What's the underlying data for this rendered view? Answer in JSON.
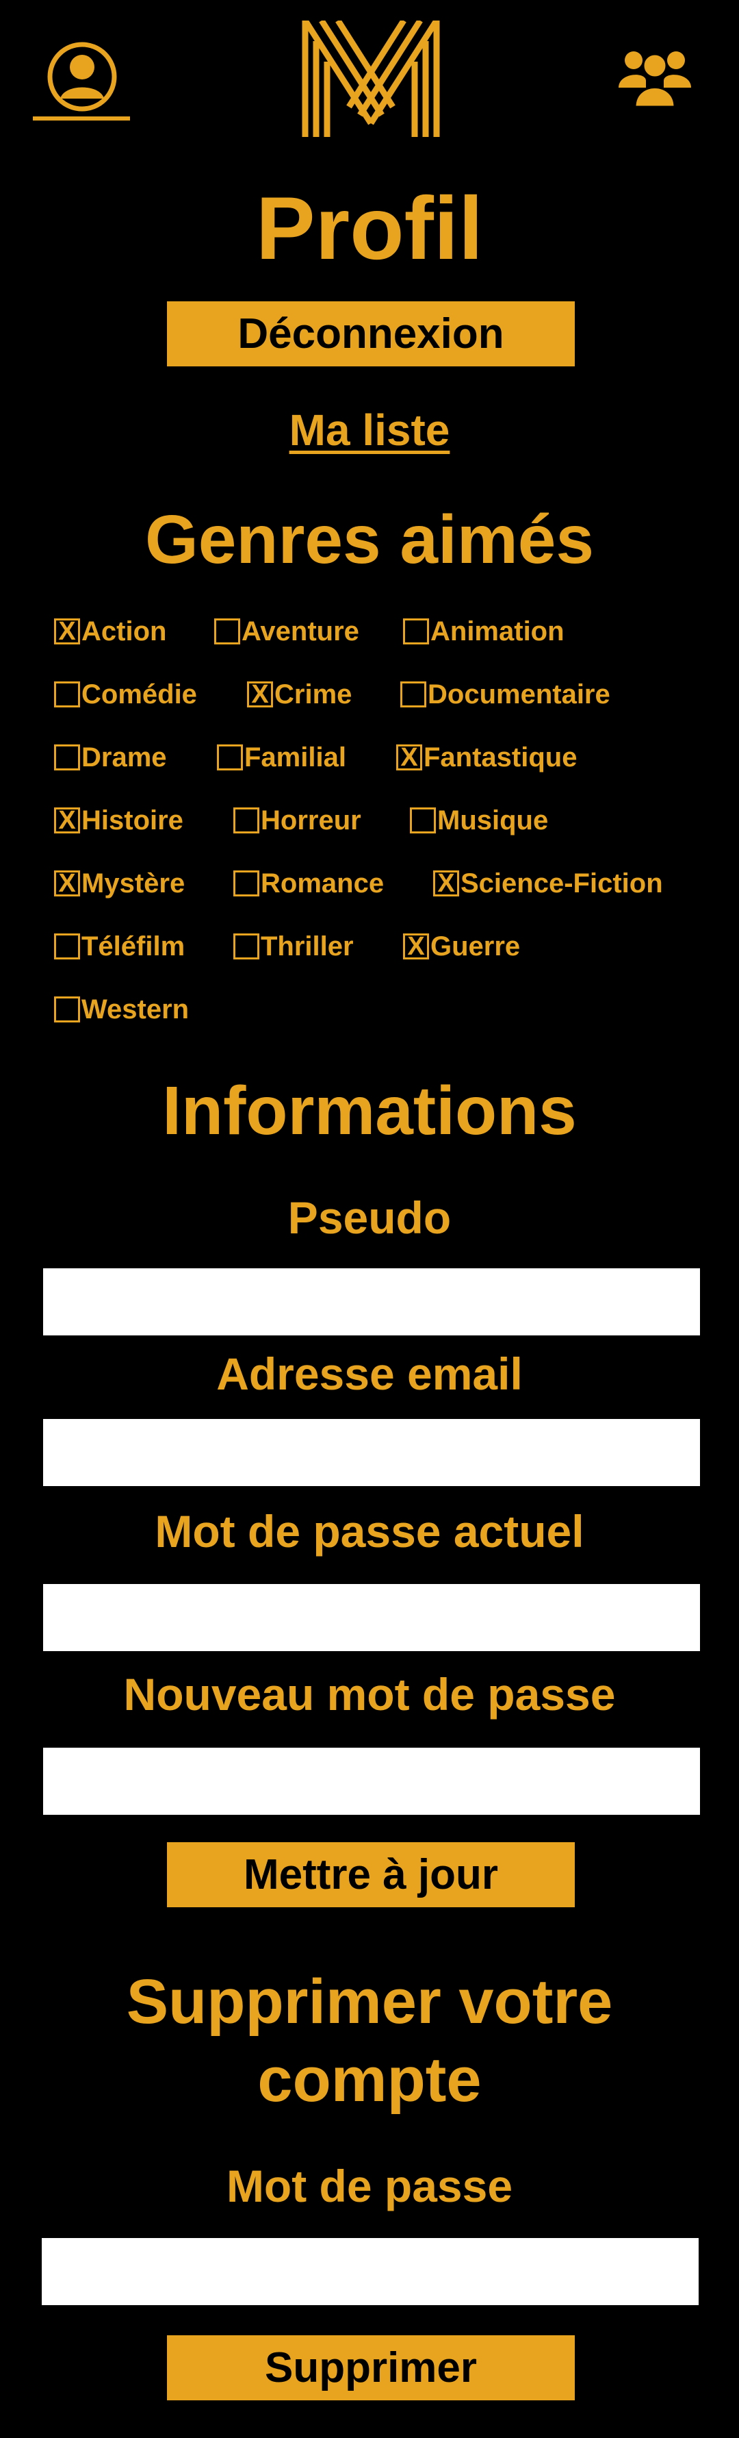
{
  "header": {
    "profile_icon": "user-circle-icon",
    "logo_icon": "m-logo",
    "users_icon": "users-group-icon"
  },
  "page": {
    "title": "Profil",
    "logout_label": "Déconnexion",
    "my_list_label": "Ma liste"
  },
  "genres": {
    "title": "Genres aimés",
    "checked_mark": "X",
    "items": [
      {
        "label": "Action",
        "checked": true
      },
      {
        "label": "Aventure",
        "checked": false
      },
      {
        "label": "Animation",
        "checked": false
      },
      {
        "label": "Comédie",
        "checked": false
      },
      {
        "label": "Crime",
        "checked": true
      },
      {
        "label": "Documentaire",
        "checked": false
      },
      {
        "label": "Drame",
        "checked": false
      },
      {
        "label": "Familial",
        "checked": false
      },
      {
        "label": "Fantastique",
        "checked": true
      },
      {
        "label": "Histoire",
        "checked": true
      },
      {
        "label": "Horreur",
        "checked": false
      },
      {
        "label": "Musique",
        "checked": false
      },
      {
        "label": "Mystère",
        "checked": true
      },
      {
        "label": "Romance",
        "checked": false
      },
      {
        "label": "Science-Fiction",
        "checked": true
      },
      {
        "label": "Téléfilm",
        "checked": false
      },
      {
        "label": "Thriller",
        "checked": false
      },
      {
        "label": "Guerre",
        "checked": true
      },
      {
        "label": "Western",
        "checked": false
      }
    ]
  },
  "info": {
    "title": "Informations",
    "pseudo_label": "Pseudo",
    "pseudo_value": "",
    "email_label": "Adresse email",
    "email_value": "",
    "current_password_label": "Mot de passe actuel",
    "current_password_value": "",
    "new_password_label": "Nouveau mot de passe",
    "new_password_value": "",
    "update_label": "Mettre à jour"
  },
  "delete_account": {
    "title_line1": "Supprimer votre",
    "title_line2": "compte",
    "password_label": "Mot de passe",
    "password_value": "",
    "delete_label": "Supprimer"
  },
  "colors": {
    "accent": "#e8a41f",
    "background": "#000000",
    "field": "#ffffff"
  }
}
